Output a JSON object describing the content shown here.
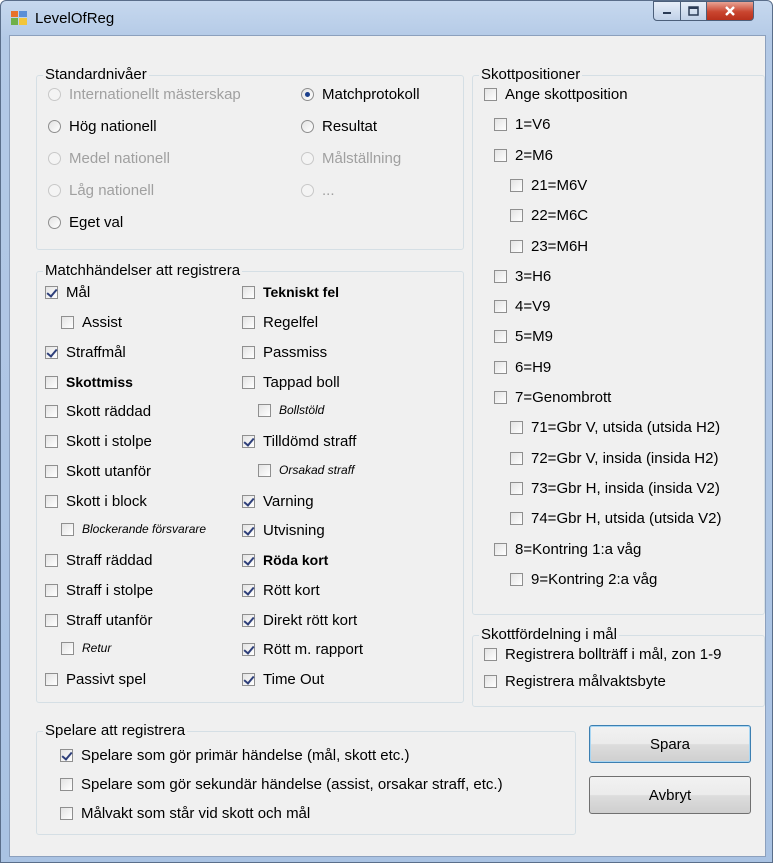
{
  "window": {
    "title": "LevelOfReg"
  },
  "standard": {
    "legend": "Standardnivåer",
    "radios": [
      {
        "label": "Internationellt mästerskap",
        "checked": false,
        "disabled": true
      },
      {
        "label": "Hög nationell",
        "checked": false,
        "disabled": false
      },
      {
        "label": "Medel nationell",
        "checked": false,
        "disabled": true
      },
      {
        "label": "Låg nationell",
        "checked": false,
        "disabled": true
      },
      {
        "label": "Eget val",
        "checked": false,
        "disabled": false
      },
      {
        "label": "Matchprotokoll",
        "checked": true,
        "disabled": false
      },
      {
        "label": "Resultat",
        "checked": false,
        "disabled": false
      },
      {
        "label": "Målställning",
        "checked": false,
        "disabled": true
      },
      {
        "label": "...",
        "checked": false,
        "disabled": true
      }
    ]
  },
  "events": {
    "legend": "Matchhändelser att registrera",
    "left": [
      {
        "label": "Mål",
        "checked": true,
        "style": "normal"
      },
      {
        "label": "Assist",
        "checked": false,
        "style": "normal"
      },
      {
        "label": "Straffmål",
        "checked": true,
        "style": "normal"
      },
      {
        "label": "Skottmiss",
        "checked": false,
        "style": "bold"
      },
      {
        "label": "Skott räddad",
        "checked": false,
        "style": "normal"
      },
      {
        "label": "Skott i stolpe",
        "checked": false,
        "style": "normal"
      },
      {
        "label": "Skott utanför",
        "checked": false,
        "style": "normal"
      },
      {
        "label": "Skott i block",
        "checked": false,
        "style": "normal"
      },
      {
        "label": "Blockerande försvarare",
        "checked": false,
        "style": "italic"
      },
      {
        "label": "Straff räddad",
        "checked": false,
        "style": "normal"
      },
      {
        "label": "Straff i stolpe",
        "checked": false,
        "style": "normal"
      },
      {
        "label": "Straff utanför",
        "checked": false,
        "style": "normal"
      },
      {
        "label": "Retur",
        "checked": false,
        "style": "italic"
      },
      {
        "label": "Passivt spel",
        "checked": false,
        "style": "normal"
      }
    ],
    "right": [
      {
        "label": "Tekniskt fel",
        "checked": false,
        "style": "bold"
      },
      {
        "label": "Regelfel",
        "checked": false,
        "style": "normal"
      },
      {
        "label": "Passmiss",
        "checked": false,
        "style": "normal"
      },
      {
        "label": "Tappad boll",
        "checked": false,
        "style": "normal"
      },
      {
        "label": "Bollstöld",
        "checked": false,
        "style": "italic"
      },
      {
        "label": "Tilldömd straff",
        "checked": true,
        "style": "normal"
      },
      {
        "label": "Orsakad straff",
        "checked": false,
        "style": "italic"
      },
      {
        "label": "Varning",
        "checked": true,
        "style": "normal"
      },
      {
        "label": "Utvisning",
        "checked": true,
        "style": "normal"
      },
      {
        "label": "Röda kort",
        "checked": true,
        "style": "bold"
      },
      {
        "label": "Rött kort",
        "checked": true,
        "style": "normal"
      },
      {
        "label": "Direkt rött kort",
        "checked": true,
        "style": "normal"
      },
      {
        "label": "Rött m. rapport",
        "checked": true,
        "style": "normal"
      },
      {
        "label": "Time Out",
        "checked": true,
        "style": "normal"
      }
    ]
  },
  "shots": {
    "legend": "Skottpositioner",
    "items": [
      {
        "label": "Ange skottposition",
        "checked": false
      },
      {
        "label": "1=V6",
        "checked": false
      },
      {
        "label": "2=M6",
        "checked": false
      },
      {
        "label": "21=M6V",
        "checked": false
      },
      {
        "label": "22=M6C",
        "checked": false
      },
      {
        "label": "23=M6H",
        "checked": false
      },
      {
        "label": "3=H6",
        "checked": false
      },
      {
        "label": "4=V9",
        "checked": false
      },
      {
        "label": "5=M9",
        "checked": false
      },
      {
        "label": "6=H9",
        "checked": false
      },
      {
        "label": "7=Genombrott",
        "checked": false
      },
      {
        "label": "71=Gbr V, utsida (utsida H2)",
        "checked": false
      },
      {
        "label": "72=Gbr V, insida (insida H2)",
        "checked": false
      },
      {
        "label": "73=Gbr H, insida (insida V2)",
        "checked": false
      },
      {
        "label": "74=Gbr H, utsida (utsida V2)",
        "checked": false
      },
      {
        "label": "8=Kontring 1:a våg",
        "checked": false
      },
      {
        "label": "9=Kontring 2:a våg",
        "checked": false
      }
    ]
  },
  "distribution": {
    "legend": "Skottfördelning i mål",
    "items": [
      {
        "label": "Registrera bollträff i mål, zon 1-9",
        "checked": false
      },
      {
        "label": "Registrera målvaktsbyte",
        "checked": false
      }
    ]
  },
  "players": {
    "legend": "Spelare att registrera",
    "items": [
      {
        "label": "Spelare som gör primär händelse (mål, skott etc.)",
        "checked": true
      },
      {
        "label": "Spelare som gör sekundär händelse (assist, orsakar straff, etc.)",
        "checked": false
      },
      {
        "label": "Målvakt som står vid skott och mål",
        "checked": false
      }
    ]
  },
  "buttons": {
    "save": "Spara",
    "cancel": "Avbryt"
  }
}
